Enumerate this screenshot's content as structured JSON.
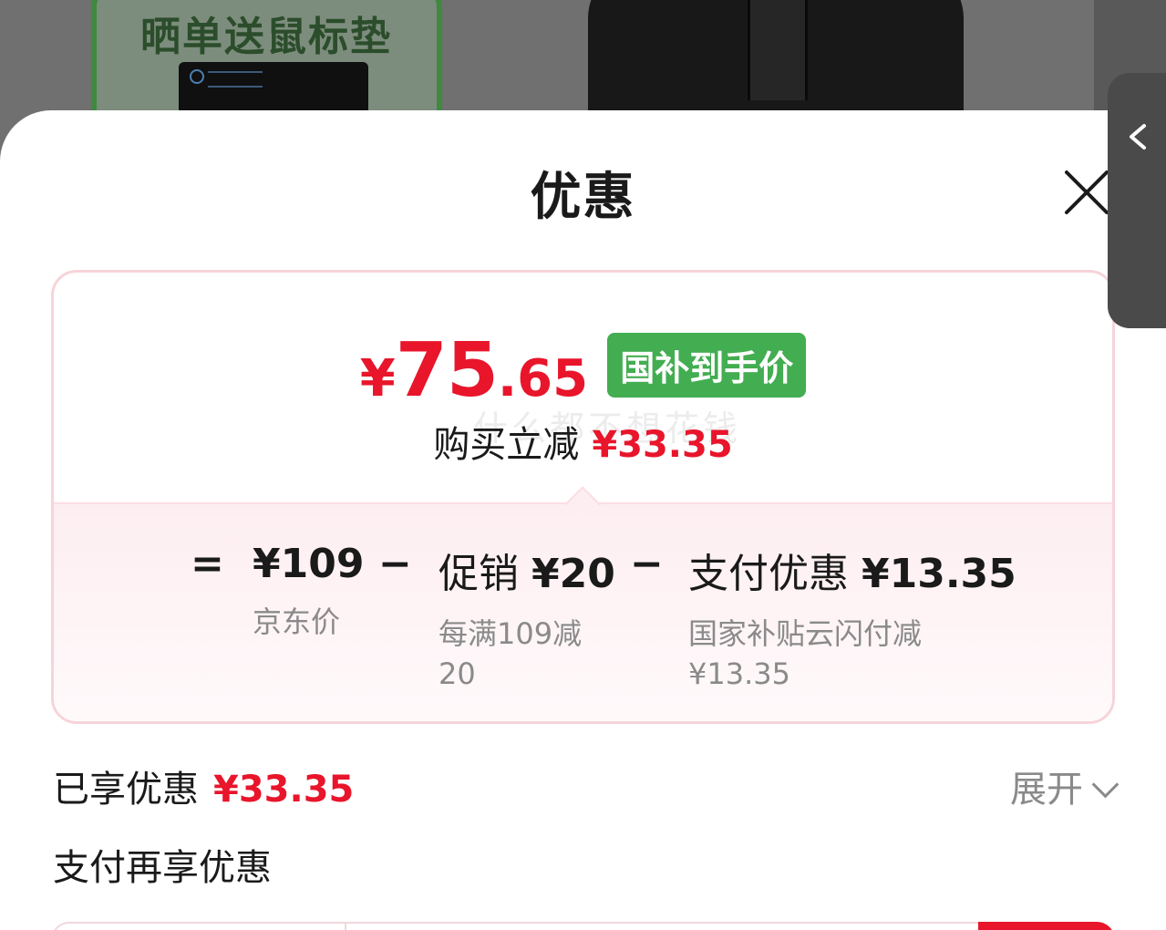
{
  "background": {
    "promo_text": "晒单送鼠标垫"
  },
  "sheet": {
    "title": "优惠"
  },
  "price": {
    "currency": "¥",
    "integer": "75",
    "decimal": ".65",
    "tag": "国补到手价",
    "saved_label": "购买立减",
    "saved_amount": "¥33.35",
    "watermark": "什么都不想花钱"
  },
  "breakdown": {
    "equals": "=",
    "minus": "−",
    "items": [
      {
        "main_label": "",
        "main_value": "¥109",
        "sub": "京东价"
      },
      {
        "main_label": "促销",
        "main_value": "¥20",
        "sub": "每满109减20"
      },
      {
        "main_label": "支付优惠",
        "main_value": "¥13.35",
        "sub": "国家补贴云闪付减¥13.35"
      }
    ]
  },
  "enjoyed": {
    "label": "已享优惠",
    "amount": "¥33.35",
    "expand_label": "展开"
  },
  "pay_section": {
    "title": "支付再享优惠"
  },
  "colors": {
    "accent_red": "#e8152b",
    "tag_green": "#43ad51",
    "card_border": "#f6d4da",
    "muted_text": "#8a8a8a"
  }
}
